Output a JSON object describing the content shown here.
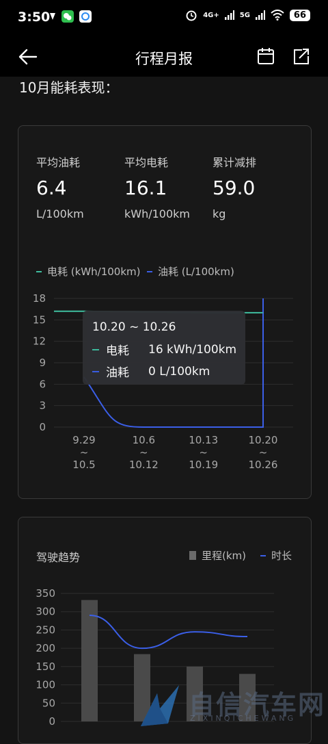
{
  "status_bar": {
    "time": "3:50",
    "network_4g": "4G+",
    "network_5g": "5G",
    "battery": "66",
    "icons": [
      "signal-arrow-icon",
      "wechat-icon",
      "messenger-icon",
      "alarm-icon",
      "signal-icon",
      "wifi-icon",
      "battery-icon"
    ]
  },
  "nav": {
    "title": "行程月报",
    "back_icon": "back-arrow-icon",
    "calendar_icon": "calendar-icon",
    "share_icon": "share-icon"
  },
  "section_title": "10月能耗表现：",
  "stats": [
    {
      "label": "平均油耗",
      "value": "6.4",
      "unit": "L/100km"
    },
    {
      "label": "平均电耗",
      "value": "16.1",
      "unit": "kWh/100km"
    },
    {
      "label": "累计减排",
      "value": "59.0",
      "unit": "kg"
    }
  ],
  "colors": {
    "electric": "#3fbfa0",
    "fuel": "#3b5fe8",
    "bar": "#4a4a4a",
    "background": "#141414"
  },
  "chart_data": [
    {
      "type": "line",
      "legend": [
        {
          "name": "电耗 (kWh/100km)",
          "color": "#3fbfa0"
        },
        {
          "name": "油耗 (L/100km)",
          "color": "#3b5fe8"
        }
      ],
      "categories": [
        [
          "9.29",
          "~",
          "10.5"
        ],
        [
          "10.6",
          "~",
          "10.12"
        ],
        [
          "10.13",
          "~",
          "10.19"
        ],
        [
          "10.20",
          "~",
          "10.26"
        ]
      ],
      "y_ticks": [
        "18",
        "15",
        "12",
        "9",
        "6",
        "3",
        "0"
      ],
      "ylim": [
        0,
        18
      ],
      "series": [
        {
          "name": "电耗",
          "values": [
            16.2,
            16.1,
            16,
            16
          ]
        },
        {
          "name": "油耗",
          "values": [
            7,
            0,
            0,
            0
          ]
        }
      ],
      "tooltip": {
        "title": "10.20 ~ 10.26",
        "rows": [
          {
            "name": "电耗",
            "value": "16 kWh/100km"
          },
          {
            "name": "油耗",
            "value": "0 L/100km"
          }
        ]
      }
    },
    {
      "type": "bar",
      "title": "驾驶趋势",
      "legend": [
        {
          "name": "里程(km)",
          "color": "#4a4a4a"
        },
        {
          "name": "时长",
          "color": "#3b5fe8"
        }
      ],
      "y_ticks": [
        "350",
        "300",
        "250",
        "200",
        "150",
        "100",
        "50",
        "0"
      ],
      "ylim": [
        0,
        350
      ],
      "series": [
        {
          "name": "里程(km)",
          "values": [
            332,
            184,
            150,
            130
          ]
        },
        {
          "name": "时长",
          "values": [
            290,
            200,
            245,
            232
          ]
        }
      ]
    }
  ],
  "watermark": {
    "text": "自信汽车网",
    "sub": "ZIXINQICHEWANG"
  }
}
